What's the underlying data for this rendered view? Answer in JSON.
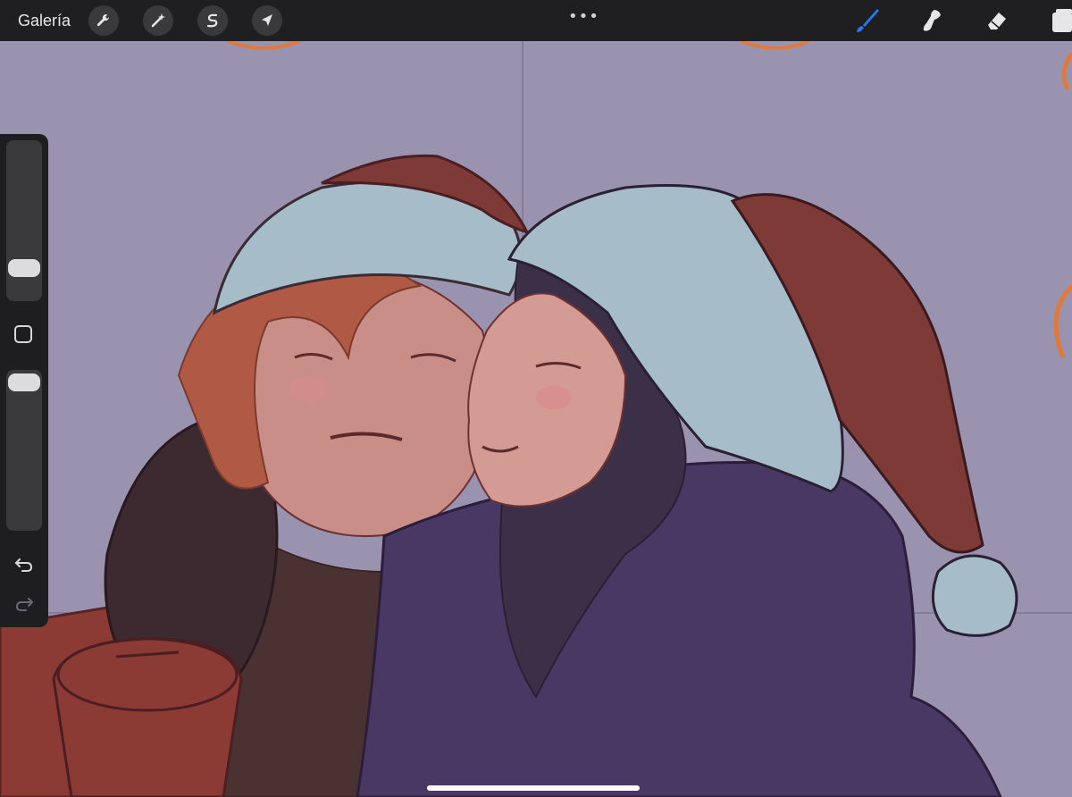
{
  "topbar": {
    "gallery_label": "Galería",
    "left_tools": [
      "wrench-icon",
      "magic-wand-icon",
      "selection-s-icon",
      "move-arrow-icon"
    ],
    "more_label": "•••",
    "right_tools": [
      "brush-icon",
      "smudge-icon",
      "eraser-icon",
      "layers-icon"
    ],
    "accent_color": "#1f7cf0"
  },
  "sidebar": {
    "brush_size_level": 0.5,
    "opacity_level": 0.07,
    "icons": [
      "undo-icon",
      "redo-icon"
    ]
  },
  "canvas": {
    "background_color": "#9a93b0",
    "description_colors": {
      "hat_red": "#7e3a36",
      "hat_white": "#a6bdc9",
      "coat_purple": "#4a3864",
      "sweater_red": "#8b3b33",
      "skin": "#c98e88",
      "hair_red": "#b05a45",
      "hair_dark": "#3c3048",
      "orange_stroke": "#e07a3a"
    }
  }
}
